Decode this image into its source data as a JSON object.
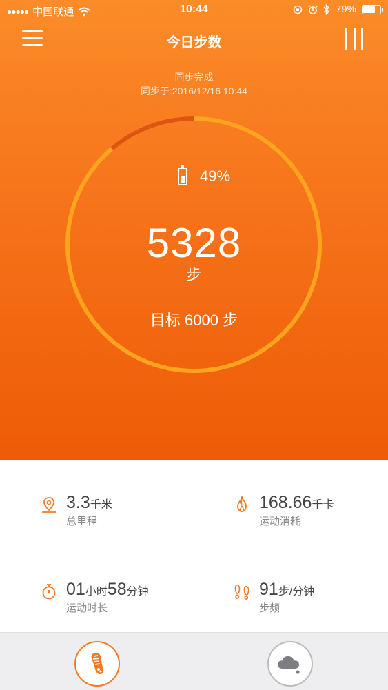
{
  "status_bar": {
    "carrier": "中国联通",
    "time": "10:44",
    "battery": "79%",
    "battery_level": 0.79,
    "icons": [
      "signal-icon",
      "wifi-icon",
      "lock-rotation-icon",
      "alarm-icon",
      "bluetooth-icon",
      "battery-icon"
    ]
  },
  "header": {
    "title": "今日步数",
    "menu_icon": "hamburger-menu-icon",
    "stats_icon": "bar-stats-icon"
  },
  "sync": {
    "status": "同步完成",
    "time": "同步于:2016/12/16 10:44"
  },
  "ring": {
    "progress": 0.888,
    "band_battery_icon": "battery-icon",
    "band_battery": "49%",
    "band_battery_level": 0.49,
    "steps": "5328",
    "steps_unit": "步",
    "goal": "目标 6000 步",
    "colors": {
      "track": "#ffa41f",
      "progress": "#de5512"
    }
  },
  "metrics": {
    "distance": {
      "icon": "location-pin-icon",
      "value": "3.3",
      "unit": "千米",
      "label": "总里程"
    },
    "calories": {
      "icon": "flame-icon",
      "value": "168.66",
      "unit": "千卡",
      "label": "运动消耗"
    },
    "duration": {
      "icon": "stopwatch-icon",
      "value_h": "01",
      "unit_h": "小时",
      "value_m": "58",
      "unit_m": "分钟",
      "label": "运动时长"
    },
    "cadence": {
      "icon": "footprints-icon",
      "value": "91",
      "unit": "步/分钟",
      "label": "步频"
    }
  },
  "tabbar": {
    "tabs": [
      {
        "icon": "running-shoe-icon",
        "active": true
      },
      {
        "icon": "weather-cloud-icon",
        "active": false
      }
    ]
  },
  "colors": {
    "accent": "#f27a24",
    "hero_top": "#fb8c28",
    "hero_bottom": "#ee5b06"
  }
}
